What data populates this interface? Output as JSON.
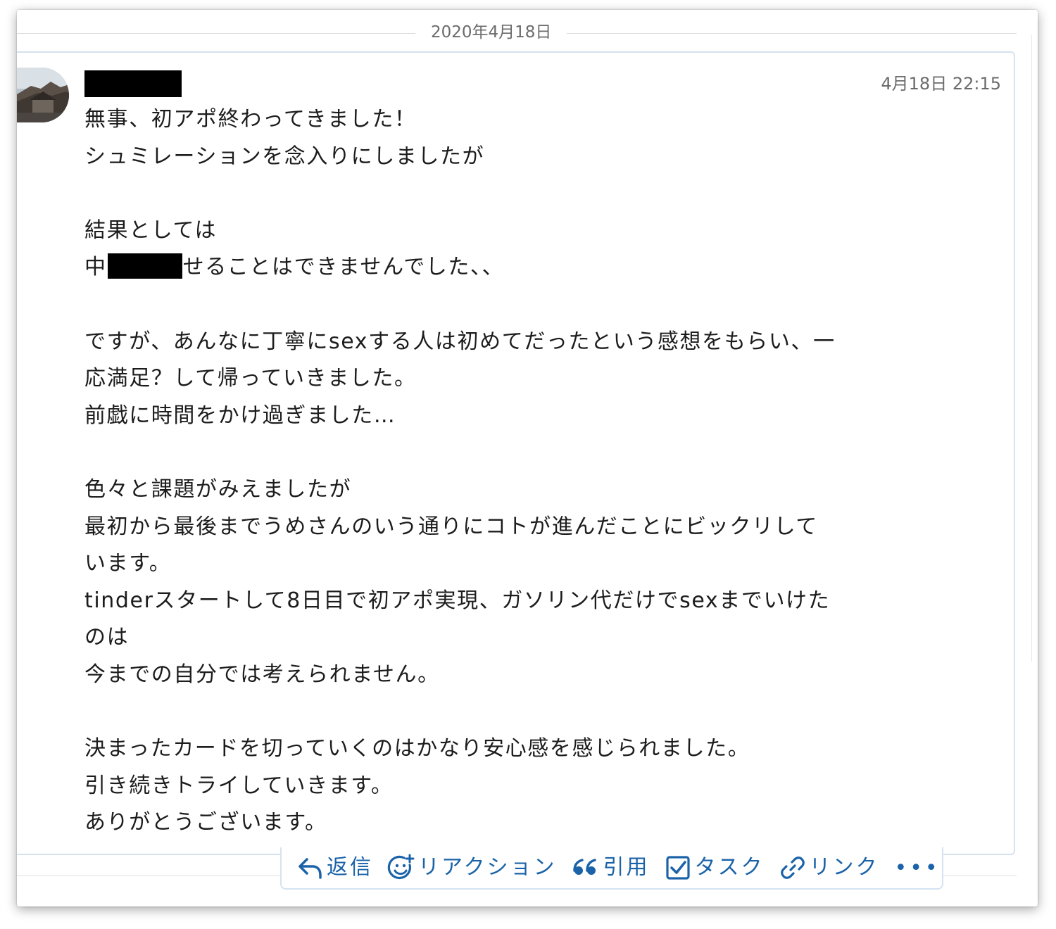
{
  "date_divider": {
    "label": "2020年4月18日"
  },
  "message": {
    "timestamp": "4月18日 22:15",
    "lines": [
      "無事、初アポ終わってきました！",
      "シュミレーションを念入りにしましたが",
      "",
      "結果としては",
      {
        "before": "中",
        "after": "せることはできませんでした、、"
      },
      "",
      "ですが、あんなに丁寧にsexする人は初めてだったという感想をもらい、一",
      "応満足？して帰っていきました。",
      "前戯に時間をかけ過ぎました…",
      "",
      "色々と課題がみえましたが",
      "最初から最後までうめさんのいう通りにコトが進んだことにビックリして",
      "います。",
      "tinderスタートして8日目で初アポ実現、ガソリン代だけでsexまでいけた",
      "のは",
      "今までの自分では考えられません。",
      "",
      "決まったカードを切っていくのはかなり安心感を感じられました。",
      "引き続きトライしていきます。",
      "ありがとうございます。"
    ]
  },
  "actions": {
    "reply": {
      "label": "返信",
      "icon": "reply-arrow-icon"
    },
    "reaction": {
      "label": "リアクション",
      "icon": "smiley-plus-icon"
    },
    "quote": {
      "label": "引用",
      "icon": "quote-marks-icon"
    },
    "task": {
      "label": "タスク",
      "icon": "checkbox-icon"
    },
    "link": {
      "label": "リンク",
      "icon": "chain-link-icon"
    },
    "more": {
      "label": "•••",
      "icon": "more-dots-icon"
    }
  },
  "colors": {
    "action_blue": "#1a63a8",
    "card_border": "#d5e3f0",
    "meta_gray": "#6b6b6b",
    "redaction": "#000000"
  }
}
